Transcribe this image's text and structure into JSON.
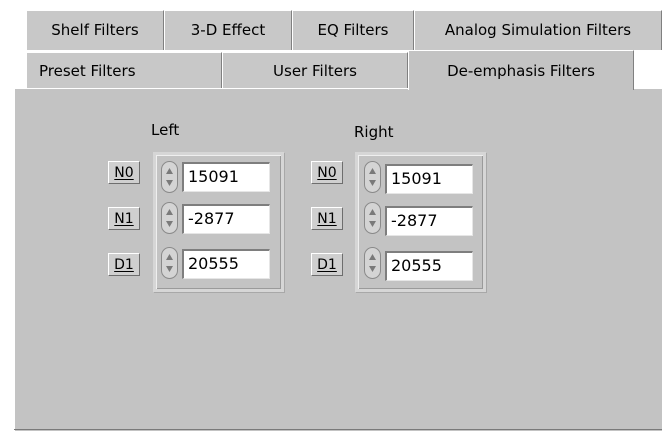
{
  "tabs_row1": [
    {
      "label": "Shelf Filters"
    },
    {
      "label": "3-D Effect"
    },
    {
      "label": "EQ Filters"
    },
    {
      "label": "Analog Simulation Filters"
    }
  ],
  "tabs_row2": [
    {
      "label": "Preset Filters"
    },
    {
      "label": "User Filters"
    },
    {
      "label": "De-emphasis Filters",
      "active": true
    }
  ],
  "left": {
    "title": "Left",
    "rows": [
      {
        "label": "N0",
        "value": "15091"
      },
      {
        "label": "N1",
        "value": "-2877"
      },
      {
        "label": "D1",
        "value": "20555"
      }
    ]
  },
  "right": {
    "title": "Right",
    "rows": [
      {
        "label": "N0",
        "value": "15091"
      },
      {
        "label": "N1",
        "value": "-2877"
      },
      {
        "label": "D1",
        "value": "20555"
      }
    ]
  },
  "icons": {
    "spinner": "up-down-arrows-icon"
  }
}
